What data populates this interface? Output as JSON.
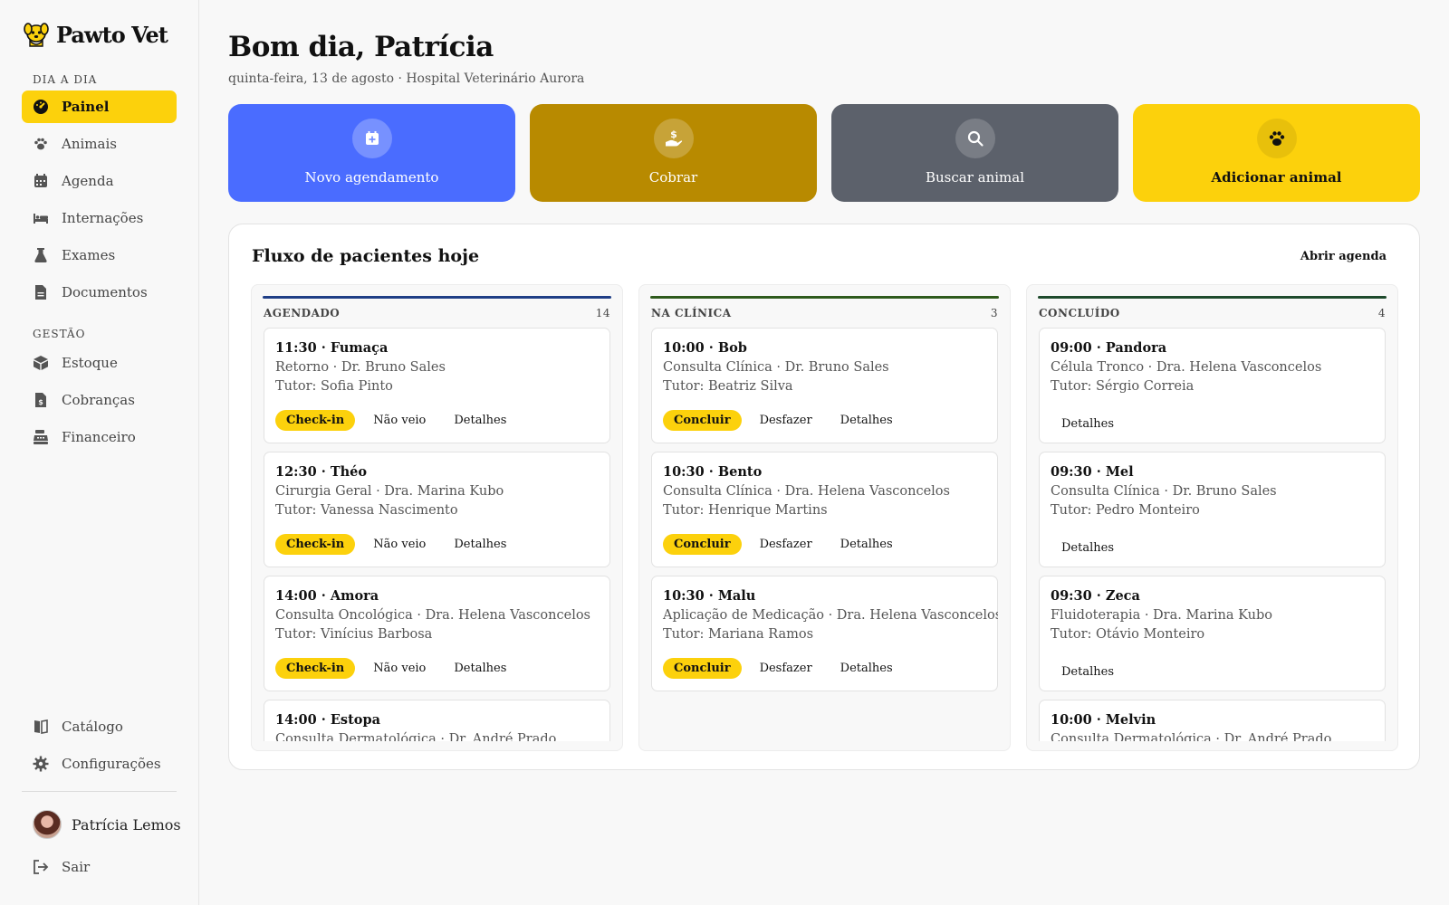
{
  "app": {
    "name": "Pawto Vet"
  },
  "sidebar": {
    "section_daily": "DIA A DIA",
    "section_management": "GESTÃO",
    "daily_items": [
      {
        "label": "Painel",
        "icon": "dashboard-icon",
        "active": true
      },
      {
        "label": "Animais",
        "icon": "paw-icon"
      },
      {
        "label": "Agenda",
        "icon": "calendar-icon"
      },
      {
        "label": "Internações",
        "icon": "bed-icon"
      },
      {
        "label": "Exames",
        "icon": "flask-icon"
      },
      {
        "label": "Documentos",
        "icon": "document-icon"
      }
    ],
    "management_items": [
      {
        "label": "Estoque",
        "icon": "box-icon"
      },
      {
        "label": "Cobranças",
        "icon": "invoice-icon"
      },
      {
        "label": "Financeiro",
        "icon": "cash-register-icon"
      }
    ],
    "bottom_items": [
      {
        "label": "Catálogo",
        "icon": "book-icon"
      },
      {
        "label": "Configurações",
        "icon": "gear-icon"
      }
    ],
    "user_name": "Patrícia Lemos",
    "logout": "Sair"
  },
  "header": {
    "greeting": "Bom dia, Patrícia",
    "subtitle": "quinta-feira, 13 de agosto · Hospital Veterinário Aurora"
  },
  "quick_actions": [
    {
      "label": "Novo agendamento",
      "icon": "calendar-plus-icon",
      "color": "#4a6cff"
    },
    {
      "label": "Cobrar",
      "icon": "hand-dollar-icon",
      "color": "#b88a00"
    },
    {
      "label": "Buscar animal",
      "icon": "search-icon",
      "color": "#5c616b"
    },
    {
      "label": "Adicionar animal",
      "icon": "paw-icon",
      "color": "#fcd10c"
    }
  ],
  "flow": {
    "title": "Fluxo de pacientes hoje",
    "open_link": "Abrir agenda",
    "columns": [
      {
        "name": "AGENDADO",
        "count": "14",
        "color": "#1f3e86",
        "cards": [
          {
            "title": "11:30 · Fumaça",
            "line1": "Retorno · Dr. Bruno Sales",
            "line2": "Tutor: Sofia Pinto",
            "primary": "Check-in",
            "secondary": "Não veio",
            "details": "Detalhes"
          },
          {
            "title": "12:30 · Théo",
            "line1": "Cirurgia Geral · Dra. Marina Kubo",
            "line2": "Tutor: Vanessa Nascimento",
            "primary": "Check-in",
            "secondary": "Não veio",
            "details": "Detalhes"
          },
          {
            "title": "14:00 · Amora",
            "line1": "Consulta Oncológica · Dra. Helena Vasconcelos",
            "line2": "Tutor: Vinícius Barbosa",
            "primary": "Check-in",
            "secondary": "Não veio",
            "details": "Detalhes"
          },
          {
            "title": "14:00 · Estopa",
            "line1": "Consulta Dermatológica · Dr. André Prado",
            "line2": "",
            "primary": "",
            "secondary": "",
            "details": ""
          }
        ]
      },
      {
        "name": "NA CLÍNICA",
        "count": "3",
        "color": "#2e5a1c",
        "cards": [
          {
            "title": "10:00 · Bob",
            "line1": "Consulta Clínica · Dr. Bruno Sales",
            "line2": "Tutor: Beatriz Silva",
            "primary": "Concluir",
            "secondary": "Desfazer",
            "details": "Detalhes"
          },
          {
            "title": "10:30 · Bento",
            "line1": "Consulta Clínica · Dra. Helena Vasconcelos",
            "line2": "Tutor: Henrique Martins",
            "primary": "Concluir",
            "secondary": "Desfazer",
            "details": "Detalhes"
          },
          {
            "title": "10:30 · Malu",
            "line1": "Aplicação de Medicação · Dra. Helena Vasconcelos",
            "line2": "Tutor: Mariana Ramos",
            "primary": "Concluir",
            "secondary": "Desfazer",
            "details": "Detalhes"
          }
        ]
      },
      {
        "name": "CONCLUÍDO",
        "count": "4",
        "color": "#1e4a2c",
        "cards": [
          {
            "title": "09:00 · Pandora",
            "line1": "Célula Tronco · Dra. Helena Vasconcelos",
            "line2": "Tutor: Sérgio Correia",
            "primary": "",
            "secondary": "",
            "details": "Detalhes"
          },
          {
            "title": "09:30 · Mel",
            "line1": "Consulta Clínica · Dr. Bruno Sales",
            "line2": "Tutor: Pedro Monteiro",
            "primary": "",
            "secondary": "",
            "details": "Detalhes"
          },
          {
            "title": "09:30 · Zeca",
            "line1": "Fluidoterapia · Dra. Marina Kubo",
            "line2": "Tutor: Otávio Monteiro",
            "primary": "",
            "secondary": "",
            "details": "Detalhes"
          },
          {
            "title": "10:00 · Melvin",
            "line1": "Consulta Dermatológica · Dr. André Prado",
            "line2": "",
            "primary": "",
            "secondary": "",
            "details": ""
          }
        ]
      }
    ]
  }
}
